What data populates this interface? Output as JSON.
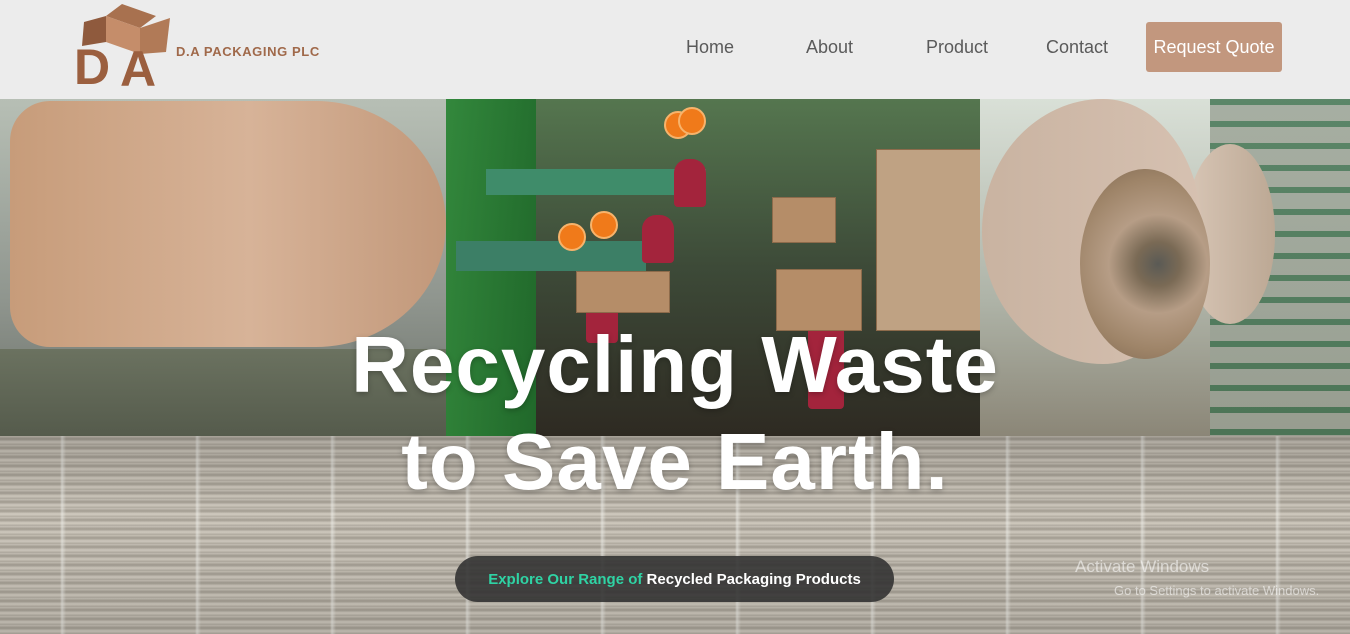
{
  "brand": {
    "logo_letters": "DA",
    "name": "D.A PACKAGING PLC",
    "color": "#a0694a"
  },
  "nav": {
    "items": [
      "Home",
      "About",
      "Product",
      "Contact"
    ],
    "cta_label": "Request Quote",
    "cta_color": "#c2977e"
  },
  "hero": {
    "headline_line1": "Recycling Waste",
    "headline_line2": "to Save Earth.",
    "cta_part1": "Explore Our Range of ",
    "cta_part2": "Recycled Packaging Products",
    "cta_accent_color": "#2fd3a4"
  },
  "watermark": {
    "line1": "Activate Windows",
    "line2": "Go to Settings to activate Windows."
  }
}
